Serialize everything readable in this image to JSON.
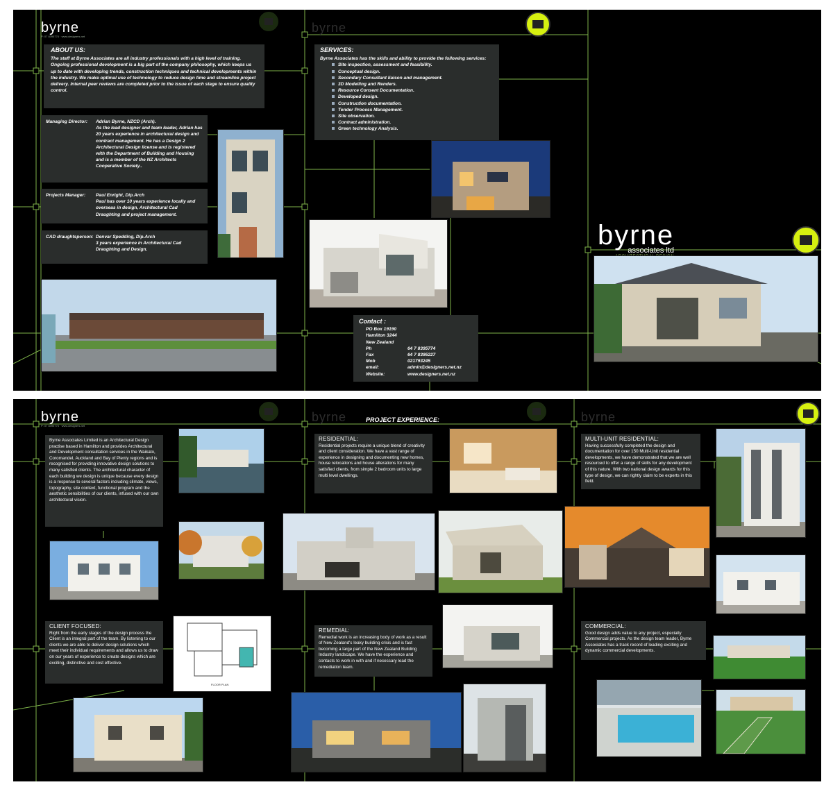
{
  "brand": {
    "name": "byrne",
    "tagline_line": "associates ltd",
    "subtitle": "ARCHITECTURAL DESIGN",
    "small_contact": "P: 07 8395774  ·  www.designers.net"
  },
  "top_sheet": {
    "about": {
      "heading": "ABOUT US:",
      "body": "The staff at Byrne Associates are all industry professionals with a high level of training. Ongoing professional development is a big part of the company philosophy, which keeps us up to date with developing trends, construction techniques and technical developments within the industry. We make optimal use of technology to reduce design time and streamline project delivery. Internal peer reviews are completed prior to the issue of each stage to ensure quality control."
    },
    "staff": [
      {
        "role": "Managing Director:",
        "name": "Adrian Byrne, NZCD (Arch).",
        "bio": "As the lead designer and team leader, Adrian has 20 years experience in architectural design and contract management. He has a Design 2 Architectural Design license and is registered with the Department of Building and Housing and is a member of the NZ Architects Cooperative Society.."
      },
      {
        "role": "Projects Manager:",
        "name": "Paul Enright, Dip.Arch",
        "bio": "Paul has over 10 years experience locally and overseas in design, Architectural Cad Draughting and project management."
      },
      {
        "role": "CAD draughtsperson:",
        "name": "Denvar Spedding, Dip.Arch",
        "bio": "3 years experience in Architectural Cad Draughting and Design."
      }
    ],
    "services": {
      "heading": "SERVICES:",
      "intro": "Byrne Associates has the skills and ability to provide the following services:",
      "items": [
        "Site inspection, assessment and feasibility.",
        "Conceptual design.",
        "Secondary Consultant liaison and management.",
        "3D Modelling and Renders.",
        "Resource Consent Documentation.",
        "Developed design.",
        "Construction documentation.",
        "Tender Process Management.",
        "Site observation.",
        "Contract administration.",
        "Green technology Analysis."
      ]
    },
    "contact": {
      "heading": "Contact :",
      "address": [
        "PO Box 19190",
        "Hamilton 3244",
        "New Zealand"
      ],
      "rows": [
        {
          "label": "Ph",
          "value": "64 7 8395774"
        },
        {
          "label": "Fax",
          "value": "64 7 8395227"
        },
        {
          "label": "Mob",
          "value": "021793245"
        },
        {
          "label": "email:",
          "value": "admin@designers.net.nz"
        },
        {
          "label": "Website:",
          "value": "www.designers.net.nz"
        }
      ]
    }
  },
  "bottom_sheet": {
    "project_heading": "PROJECT EXPERIENCE:",
    "intro": "Byrne Associates Limited is an Architectural Design practise based in Hamilton and provides Architectural and Development consultation services in the Waikato, Coromandel, Auckland and Bay of Plenty regions and is recognised for providing innovative design solutions to many satisfied clients. The architectural character of each building we design is unique because every design is a response to several factors including climate, views, topography, site context, functional program and the aesthetic sensibilities of our clients, infused with our own architectural vision.",
    "client": {
      "heading": "CLIENT FOCUSED:",
      "body": "Right from the early stages of the design process the Client is an integral part of the team. By listening to our clients we are able to deliver design solutions which meet their individual requirements and allows us to draw on our years of experience to create designs which are exciting, distinctive and cost effective."
    },
    "residential": {
      "heading": "RESIDENTIAL:",
      "body": "Residential projects require a unique blend of creativity and client consideration. We have a vast range of experience in designing and documenting new homes, house relocations and house alterations for many satisfied clients, from simple 2 bedroom units to large multi level dwellings."
    },
    "remedial": {
      "heading": "REMEDIAL:",
      "body": "Remedial work is an increasing body of work as a result of New Zealand's leaky building crisis and is fast becoming a large part of the New Zealand Building Industry landscape. We have the experience and contacts to work in with and if necessary lead the remediation team."
    },
    "multi": {
      "heading": "MULTI-UNIT RESIDENTIAL:",
      "body": "Having successfully completed the design and documentation for over 150 Multi-Unit residential developments, we have demonstrated that we are well resourced to offer a range of skills for any development of this nature. With two national design awards for this type of design, we can rightly claim to be experts in this field."
    },
    "commercial": {
      "heading": "COMMERCIAL:",
      "body": "Good design adds value to any project, especially Commercial projects. As the design team leader, Byrne Associates has a track record of leading exciting and dynamic commercial developments."
    },
    "floor_plan_label": "FLOOR PLAN"
  },
  "colors": {
    "accent": "#a9d66a",
    "panel": "#2a2d2c",
    "badge": "#d6f010"
  }
}
